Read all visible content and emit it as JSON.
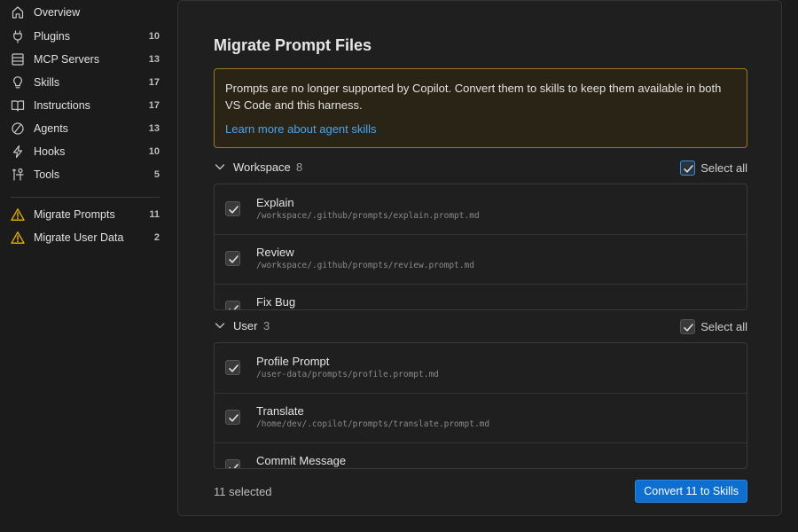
{
  "sidebar": {
    "items": [
      {
        "label": "Overview",
        "count": "",
        "icon": "home-icon"
      },
      {
        "label": "Plugins",
        "count": "10",
        "icon": "plug-icon"
      },
      {
        "label": "MCP Servers",
        "count": "13",
        "icon": "server-icon"
      },
      {
        "label": "Skills",
        "count": "17",
        "icon": "lightbulb-icon"
      },
      {
        "label": "Instructions",
        "count": "17",
        "icon": "book-icon"
      },
      {
        "label": "Agents",
        "count": "13",
        "icon": "agent-icon"
      },
      {
        "label": "Hooks",
        "count": "10",
        "icon": "lightning-icon"
      },
      {
        "label": "Tools",
        "count": "5",
        "icon": "tools-icon"
      }
    ],
    "migrate_items": [
      {
        "label": "Migrate Prompts",
        "count": "11",
        "icon": "warning-icon"
      },
      {
        "label": "Migrate User Data",
        "count": "2",
        "icon": "warning-icon"
      }
    ]
  },
  "main": {
    "title": "Migrate Prompt Files",
    "warning": {
      "message": "Prompts are no longer supported by Copilot. Convert them to skills to keep them available in both VS Code and this harness.",
      "link": "Learn more about agent skills"
    },
    "groups": [
      {
        "name": "Workspace",
        "count": "8",
        "select_all": "Select all",
        "items": [
          {
            "name": "Explain",
            "path": "/workspace/.github/prompts/explain.prompt.md"
          },
          {
            "name": "Review",
            "path": "/workspace/.github/prompts/review.prompt.md"
          },
          {
            "name": "Fix Bug",
            "path": ""
          }
        ]
      },
      {
        "name": "User",
        "count": "3",
        "select_all": "Select all",
        "items": [
          {
            "name": "Profile Prompt",
            "path": "/user-data/prompts/profile.prompt.md"
          },
          {
            "name": "Translate",
            "path": "/home/dev/.copilot/prompts/translate.prompt.md"
          },
          {
            "name": "Commit Message",
            "path": ""
          }
        ]
      }
    ],
    "footer": {
      "selected": "11 selected",
      "convert_label": "Convert 11 to Skills"
    }
  },
  "colors": {
    "accent": "#0e6fd0",
    "warning": "#e5b400",
    "link": "#4aa3ee"
  }
}
